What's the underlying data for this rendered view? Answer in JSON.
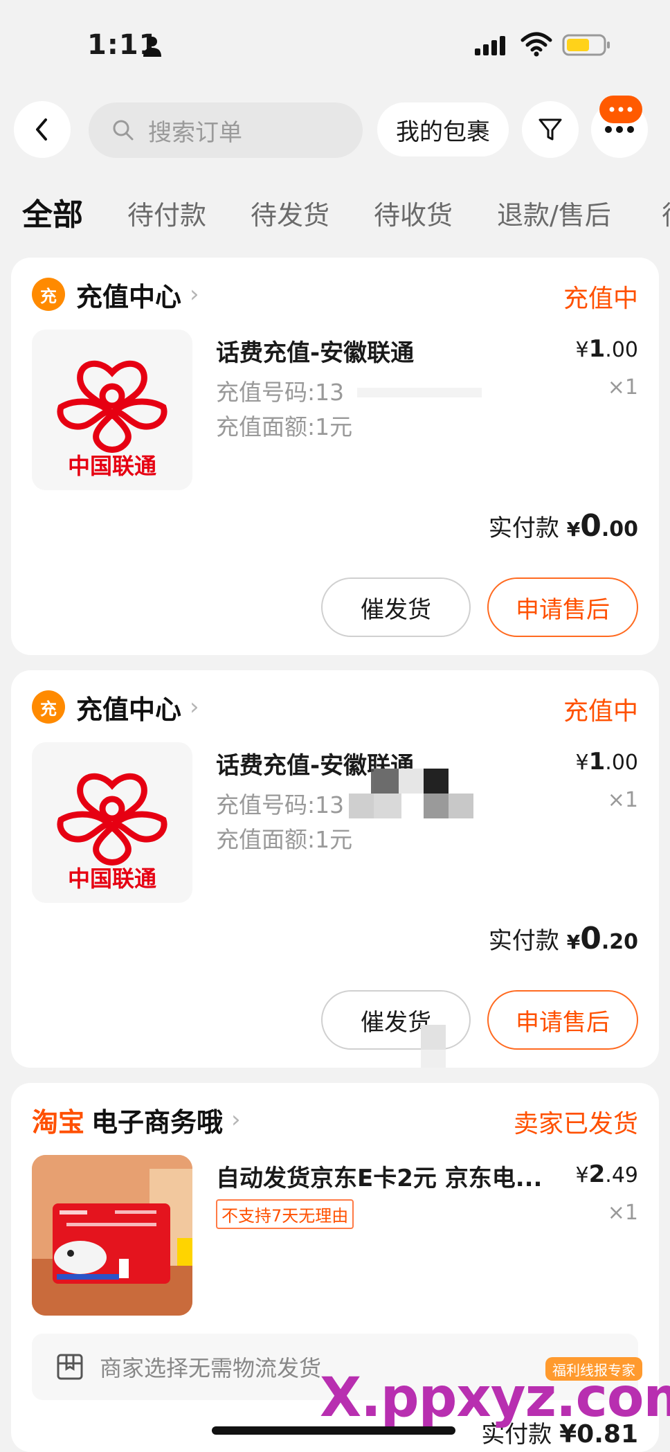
{
  "status_bar": {
    "time": "1:11"
  },
  "header": {
    "search_placeholder": "搜索订单",
    "packages_label": "我的包裹"
  },
  "tabs": [
    "全部",
    "待付款",
    "待发货",
    "待收货",
    "退款/售后",
    "待"
  ],
  "orders": [
    {
      "shop_badge": "充",
      "shop_name": "充值中心",
      "status": "充值中",
      "product_title": "话费充值-安徽联通",
      "spec_1": "充值号码:13",
      "spec_2": "充值面额:1元",
      "logo_text": "中国联通",
      "price_symbol": "¥",
      "price_int": "1",
      "price_dec": ".00",
      "qty": "×1",
      "paid_label": "实付款",
      "paid_int": "0",
      "paid_dec": ".00",
      "btn_urge": "催发货",
      "btn_after": "申请售后"
    },
    {
      "shop_badge": "充",
      "shop_name": "充值中心",
      "status": "充值中",
      "product_title": "话费充值-安徽联通",
      "spec_1": "充值号码:13",
      "spec_2": "充值面额:1元",
      "logo_text": "中国联通",
      "price_symbol": "¥",
      "price_int": "1",
      "price_dec": ".00",
      "qty": "×1",
      "paid_label": "实付款",
      "paid_int": "0",
      "paid_dec": ".20",
      "btn_urge": "催发货",
      "btn_after": "申请售后"
    },
    {
      "shop_logo": "淘宝",
      "shop_name": "电子商务哦",
      "status": "卖家已发货",
      "product_title": "自动发货京东E卡2元 京东电...",
      "tag": "不支持7天无理由",
      "price_symbol": "¥",
      "price_int": "2",
      "price_dec": ".49",
      "qty": "×1",
      "shipping_note": "商家选择无需物流发货",
      "paid_label": "实付款",
      "paid_partial": "¥0.81"
    }
  ],
  "watermark": {
    "text": "X.ppxyz.com",
    "tag": "福利线报专家"
  },
  "colors": {
    "accent": "#ff5000",
    "badge": "#ff8a00",
    "unicom_red": "#e60012"
  }
}
